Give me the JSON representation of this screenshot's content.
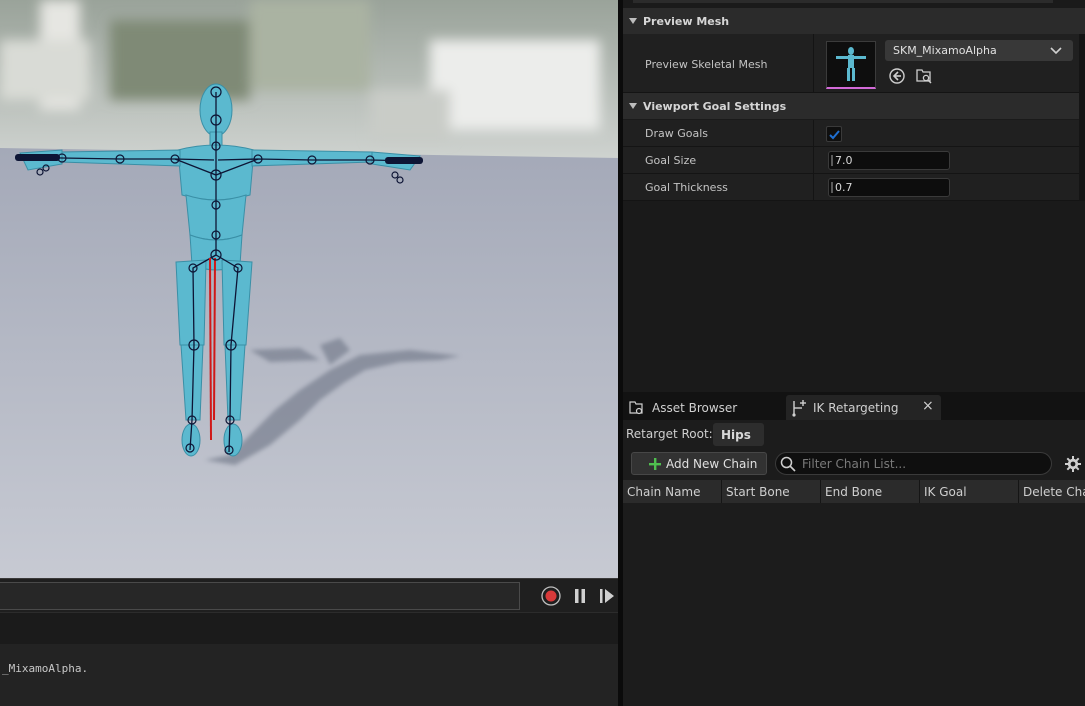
{
  "timeline": {
    "icons": [
      "record-icon",
      "pause-icon",
      "step-forward-icon"
    ]
  },
  "output_log": {
    "line": "_MixamoAlpha."
  },
  "details": {
    "preview_mesh": {
      "section_title": "Preview Mesh",
      "label": "Preview Skeletal Mesh",
      "asset_name": "SKM_MixamoAlpha",
      "icons": [
        "browse-back-icon",
        "find-in-browser-icon",
        "chevron-down-icon"
      ]
    },
    "goal_settings": {
      "section_title": "Viewport Goal Settings",
      "draw_goals_label": "Draw Goals",
      "draw_goals_checked": true,
      "goal_size_label": "Goal Size",
      "goal_size_value": "7.0",
      "goal_thickness_label": "Goal Thickness",
      "goal_thickness_value": "0.7"
    }
  },
  "tabs": {
    "asset_browser": "Asset Browser",
    "ik_retargeting": "IK Retargeting",
    "close_symbol": "×"
  },
  "ik_retargeting": {
    "retarget_root_label": "Retarget Root:",
    "retarget_root_value": "Hips",
    "add_chain_label": "Add New Chain",
    "filter_placeholder": "Filter Chain List...",
    "columns": [
      "Chain Name",
      "Start Bone",
      "End Bone",
      "IK Goal",
      "Delete Cha"
    ]
  },
  "colors": {
    "accent_blue": "#1f6fd1",
    "record_red": "#d93a3a",
    "add_green": "#4fbf4f",
    "mannequin": "#5bb9cf"
  }
}
